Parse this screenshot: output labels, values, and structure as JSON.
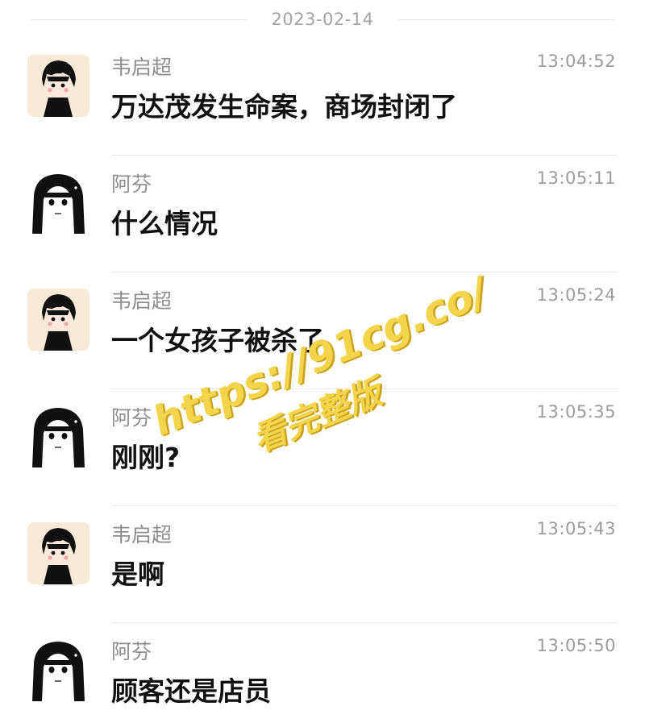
{
  "date_separator": "2023-02-14",
  "messages": [
    {
      "sender": "韦启超",
      "time": "13:04:52",
      "text": "万达茂发生命案，商场封闭了",
      "avatar": "boy-avatar"
    },
    {
      "sender": "阿芬",
      "time": "13:05:11",
      "text": "什么情况",
      "avatar": "girl-avatar"
    },
    {
      "sender": "韦启超",
      "time": "13:05:24",
      "text": "一个女孩子被杀了",
      "avatar": "boy-avatar"
    },
    {
      "sender": "阿芬",
      "time": "13:05:35",
      "text": "刚刚?",
      "avatar": "girl-avatar"
    },
    {
      "sender": "韦启超",
      "time": "13:05:43",
      "text": "是啊",
      "avatar": "boy-avatar"
    },
    {
      "sender": "阿芬",
      "time": "13:05:50",
      "text": "顾客还是店员",
      "avatar": "girl-avatar"
    }
  ],
  "watermark": {
    "url": "https://91cg.co/",
    "cta": "看完整版",
    "color": "#f4d44a"
  }
}
